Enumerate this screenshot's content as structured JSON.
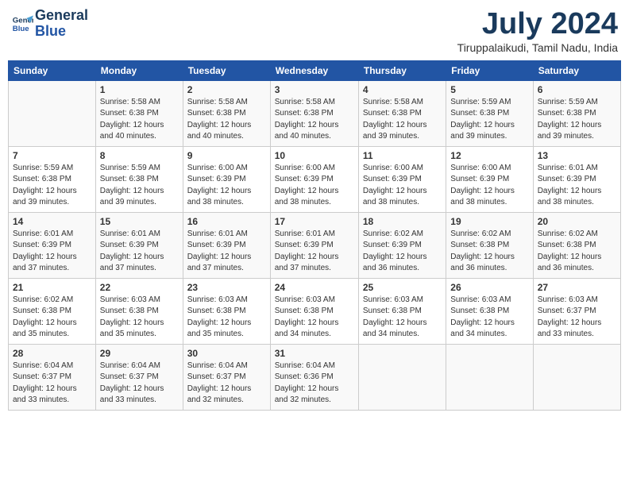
{
  "header": {
    "logo_line1": "General",
    "logo_line2": "Blue",
    "month": "July 2024",
    "location": "Tiruppalaikudi, Tamil Nadu, India"
  },
  "days_of_week": [
    "Sunday",
    "Monday",
    "Tuesday",
    "Wednesday",
    "Thursday",
    "Friday",
    "Saturday"
  ],
  "weeks": [
    [
      {
        "day": "",
        "content": ""
      },
      {
        "day": "1",
        "content": "Sunrise: 5:58 AM\nSunset: 6:38 PM\nDaylight: 12 hours\nand 40 minutes."
      },
      {
        "day": "2",
        "content": "Sunrise: 5:58 AM\nSunset: 6:38 PM\nDaylight: 12 hours\nand 40 minutes."
      },
      {
        "day": "3",
        "content": "Sunrise: 5:58 AM\nSunset: 6:38 PM\nDaylight: 12 hours\nand 40 minutes."
      },
      {
        "day": "4",
        "content": "Sunrise: 5:58 AM\nSunset: 6:38 PM\nDaylight: 12 hours\nand 39 minutes."
      },
      {
        "day": "5",
        "content": "Sunrise: 5:59 AM\nSunset: 6:38 PM\nDaylight: 12 hours\nand 39 minutes."
      },
      {
        "day": "6",
        "content": "Sunrise: 5:59 AM\nSunset: 6:38 PM\nDaylight: 12 hours\nand 39 minutes."
      }
    ],
    [
      {
        "day": "7",
        "content": "Sunrise: 5:59 AM\nSunset: 6:38 PM\nDaylight: 12 hours\nand 39 minutes."
      },
      {
        "day": "8",
        "content": "Sunrise: 5:59 AM\nSunset: 6:38 PM\nDaylight: 12 hours\nand 39 minutes."
      },
      {
        "day": "9",
        "content": "Sunrise: 6:00 AM\nSunset: 6:39 PM\nDaylight: 12 hours\nand 38 minutes."
      },
      {
        "day": "10",
        "content": "Sunrise: 6:00 AM\nSunset: 6:39 PM\nDaylight: 12 hours\nand 38 minutes."
      },
      {
        "day": "11",
        "content": "Sunrise: 6:00 AM\nSunset: 6:39 PM\nDaylight: 12 hours\nand 38 minutes."
      },
      {
        "day": "12",
        "content": "Sunrise: 6:00 AM\nSunset: 6:39 PM\nDaylight: 12 hours\nand 38 minutes."
      },
      {
        "day": "13",
        "content": "Sunrise: 6:01 AM\nSunset: 6:39 PM\nDaylight: 12 hours\nand 38 minutes."
      }
    ],
    [
      {
        "day": "14",
        "content": "Sunrise: 6:01 AM\nSunset: 6:39 PM\nDaylight: 12 hours\nand 37 minutes."
      },
      {
        "day": "15",
        "content": "Sunrise: 6:01 AM\nSunset: 6:39 PM\nDaylight: 12 hours\nand 37 minutes."
      },
      {
        "day": "16",
        "content": "Sunrise: 6:01 AM\nSunset: 6:39 PM\nDaylight: 12 hours\nand 37 minutes."
      },
      {
        "day": "17",
        "content": "Sunrise: 6:01 AM\nSunset: 6:39 PM\nDaylight: 12 hours\nand 37 minutes."
      },
      {
        "day": "18",
        "content": "Sunrise: 6:02 AM\nSunset: 6:39 PM\nDaylight: 12 hours\nand 36 minutes."
      },
      {
        "day": "19",
        "content": "Sunrise: 6:02 AM\nSunset: 6:38 PM\nDaylight: 12 hours\nand 36 minutes."
      },
      {
        "day": "20",
        "content": "Sunrise: 6:02 AM\nSunset: 6:38 PM\nDaylight: 12 hours\nand 36 minutes."
      }
    ],
    [
      {
        "day": "21",
        "content": "Sunrise: 6:02 AM\nSunset: 6:38 PM\nDaylight: 12 hours\nand 35 minutes."
      },
      {
        "day": "22",
        "content": "Sunrise: 6:03 AM\nSunset: 6:38 PM\nDaylight: 12 hours\nand 35 minutes."
      },
      {
        "day": "23",
        "content": "Sunrise: 6:03 AM\nSunset: 6:38 PM\nDaylight: 12 hours\nand 35 minutes."
      },
      {
        "day": "24",
        "content": "Sunrise: 6:03 AM\nSunset: 6:38 PM\nDaylight: 12 hours\nand 34 minutes."
      },
      {
        "day": "25",
        "content": "Sunrise: 6:03 AM\nSunset: 6:38 PM\nDaylight: 12 hours\nand 34 minutes."
      },
      {
        "day": "26",
        "content": "Sunrise: 6:03 AM\nSunset: 6:38 PM\nDaylight: 12 hours\nand 34 minutes."
      },
      {
        "day": "27",
        "content": "Sunrise: 6:03 AM\nSunset: 6:37 PM\nDaylight: 12 hours\nand 33 minutes."
      }
    ],
    [
      {
        "day": "28",
        "content": "Sunrise: 6:04 AM\nSunset: 6:37 PM\nDaylight: 12 hours\nand 33 minutes."
      },
      {
        "day": "29",
        "content": "Sunrise: 6:04 AM\nSunset: 6:37 PM\nDaylight: 12 hours\nand 33 minutes."
      },
      {
        "day": "30",
        "content": "Sunrise: 6:04 AM\nSunset: 6:37 PM\nDaylight: 12 hours\nand 32 minutes."
      },
      {
        "day": "31",
        "content": "Sunrise: 6:04 AM\nSunset: 6:36 PM\nDaylight: 12 hours\nand 32 minutes."
      },
      {
        "day": "",
        "content": ""
      },
      {
        "day": "",
        "content": ""
      },
      {
        "day": "",
        "content": ""
      }
    ]
  ]
}
